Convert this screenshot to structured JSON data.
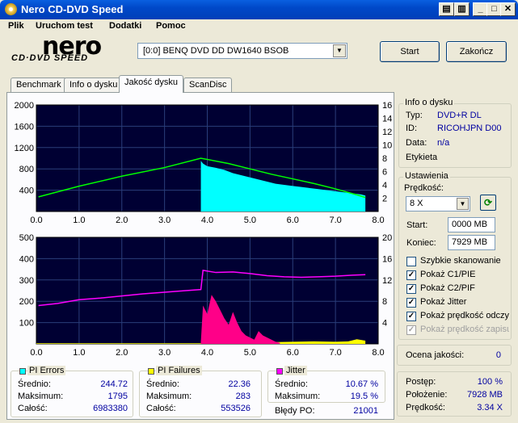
{
  "window": {
    "title": "Nero CD-DVD Speed"
  },
  "menu": [
    "Plik",
    "Uruchom test",
    "Dodatki",
    "Pomoc"
  ],
  "logo": {
    "main": "nero",
    "sub": "CD·DVD SPEED"
  },
  "drive": {
    "selected": "[0:0]  BENQ DVD DD DW1640 BSOB"
  },
  "buttons": {
    "start": "Start",
    "close": "Zakończ"
  },
  "tabs": [
    "Benchmark",
    "Info o dysku",
    "Jakość dysku",
    "ScanDisc"
  ],
  "disc_info": {
    "title": "Info o dysku",
    "type_label": "Typ:",
    "type": "DVD+R DL",
    "id_label": "ID:",
    "id": "RICOHJPN D00",
    "date_label": "Data:",
    "date": "n/a",
    "label_label": "Etykieta"
  },
  "settings": {
    "title": "Ustawienia",
    "speed_label": "Prędkość:",
    "speed": "8 X",
    "start_label": "Start:",
    "start": "0000 MB",
    "end_label": "Koniec:",
    "end": "7929 MB",
    "checkboxes": [
      {
        "label": "Szybkie skanowanie",
        "checked": false,
        "enabled": true
      },
      {
        "label": "Pokaż C1/PIE",
        "checked": true,
        "enabled": true
      },
      {
        "label": "Pokaż C2/PIF",
        "checked": true,
        "enabled": true
      },
      {
        "label": "Pokaż Jitter",
        "checked": true,
        "enabled": true
      },
      {
        "label": "Pokaż prędkość odczytu",
        "checked": true,
        "enabled": true
      },
      {
        "label": "Pokaż prędkość zapisu",
        "checked": true,
        "enabled": false
      }
    ]
  },
  "quality": {
    "label": "Ocena jakości:",
    "value": "0"
  },
  "progress": {
    "progress_label": "Postęp:",
    "progress": "100 %",
    "position_label": "Położenie:",
    "position": "7928 MB",
    "speed_label": "Prędkość:",
    "speed": "3.34 X"
  },
  "stats": {
    "pie": {
      "title": "PI Errors",
      "color": "#00ffff",
      "avg_label": "Średnio:",
      "avg": "244.72",
      "max_label": "Maksimum:",
      "max": "1795",
      "total_label": "Całość:",
      "total": "6983380"
    },
    "pif": {
      "title": "PI Failures",
      "color": "#ffff00",
      "avg_label": "Średnio:",
      "avg": "22.36",
      "max_label": "Maksimum:",
      "max": "283",
      "total_label": "Całość:",
      "total": "553526"
    },
    "jitter": {
      "title": "Jitter",
      "color": "#ff00ff",
      "avg_label": "Średnio:",
      "avg": "10.67 %",
      "max_label": "Maksimum:",
      "max": "19.5 %",
      "po_label": "Błędy PO:",
      "po": "21001"
    }
  },
  "chart_data": [
    {
      "type": "area",
      "xlim": [
        0,
        8
      ],
      "ylim": [
        0,
        2000
      ],
      "y2lim": [
        0,
        16
      ],
      "x_ticks": [
        "0.0",
        "1.0",
        "2.0",
        "3.0",
        "4.0",
        "5.0",
        "6.0",
        "7.0",
        "8.0"
      ],
      "y_ticks": [
        "400",
        "800",
        "1200",
        "1600",
        "2000"
      ],
      "y2_ticks": [
        "2",
        "4",
        "6",
        "8",
        "10",
        "12",
        "14",
        "16"
      ],
      "series": [
        {
          "color": "#00ffff",
          "x": [
            3.85,
            3.9,
            4.0,
            4.2,
            4.4,
            4.6,
            4.8,
            5.0,
            5.2,
            5.4,
            5.6,
            5.8,
            6.0,
            6.2,
            6.4,
            6.6,
            6.8,
            7.0,
            7.2,
            7.4,
            7.6,
            7.7
          ],
          "y": [
            950,
            900,
            850,
            820,
            780,
            720,
            680,
            640,
            600,
            560,
            520,
            500,
            480,
            460,
            440,
            420,
            400,
            380,
            360,
            340,
            320,
            300
          ]
        },
        {
          "color": "#00ff00",
          "x": [
            0.05,
            1,
            2,
            3,
            3.85,
            4.5,
            5,
            5.5,
            6,
            6.5,
            7,
            7.5,
            7.7
          ],
          "y": [
            2.2,
            3.8,
            5.3,
            6.6,
            8.0,
            7.2,
            6.4,
            5.6,
            4.9,
            4.2,
            3.4,
            2.5,
            2.1
          ]
        }
      ]
    },
    {
      "type": "area",
      "xlim": [
        0,
        8
      ],
      "ylim": [
        0,
        500
      ],
      "y2lim": [
        0,
        20
      ],
      "x_ticks": [
        "0.0",
        "1.0",
        "2.0",
        "3.0",
        "4.0",
        "5.0",
        "6.0",
        "7.0",
        "8.0"
      ],
      "y_ticks": [
        "100",
        "200",
        "300",
        "400",
        "500"
      ],
      "y2_ticks": [
        "4",
        "8",
        "12",
        "16",
        "20"
      ],
      "series": [
        {
          "color": "#ff00ff",
          "x": [
            0.05,
            0.5,
            1,
            1.5,
            2,
            2.5,
            3,
            3.5,
            3.85,
            3.9,
            4.2,
            4.6,
            5,
            5.4,
            5.8,
            6.2,
            6.6,
            7,
            7.4,
            7.7
          ],
          "y": [
            7.2,
            7.6,
            8.3,
            8.6,
            9.0,
            9.4,
            9.7,
            10.0,
            10.2,
            13.8,
            13.4,
            13.5,
            13.2,
            12.8,
            12.6,
            12.5,
            12.6,
            12.7,
            12.9,
            13.0
          ]
        },
        {
          "color": "#ff0088",
          "x": [
            3.85,
            3.9,
            4.0,
            4.1,
            4.2,
            4.3,
            4.4,
            4.5,
            4.6,
            4.7,
            4.8,
            4.9,
            5.0,
            5.1,
            5.2,
            5.3,
            5.4,
            5.5,
            5.6,
            5.7
          ],
          "y": [
            10,
            180,
            140,
            230,
            200,
            160,
            120,
            90,
            150,
            100,
            60,
            40,
            30,
            20,
            60,
            40,
            30,
            20,
            10,
            5
          ]
        },
        {
          "color": "#ffff00",
          "x": [
            0,
            3.85,
            4.0,
            4.5,
            5.0,
            5.5,
            6.0,
            6.5,
            7.0,
            7.3,
            7.5,
            7.7
          ],
          "y": [
            3,
            3,
            10,
            15,
            12,
            8,
            10,
            12,
            10,
            12,
            22,
            15
          ]
        }
      ]
    }
  ]
}
